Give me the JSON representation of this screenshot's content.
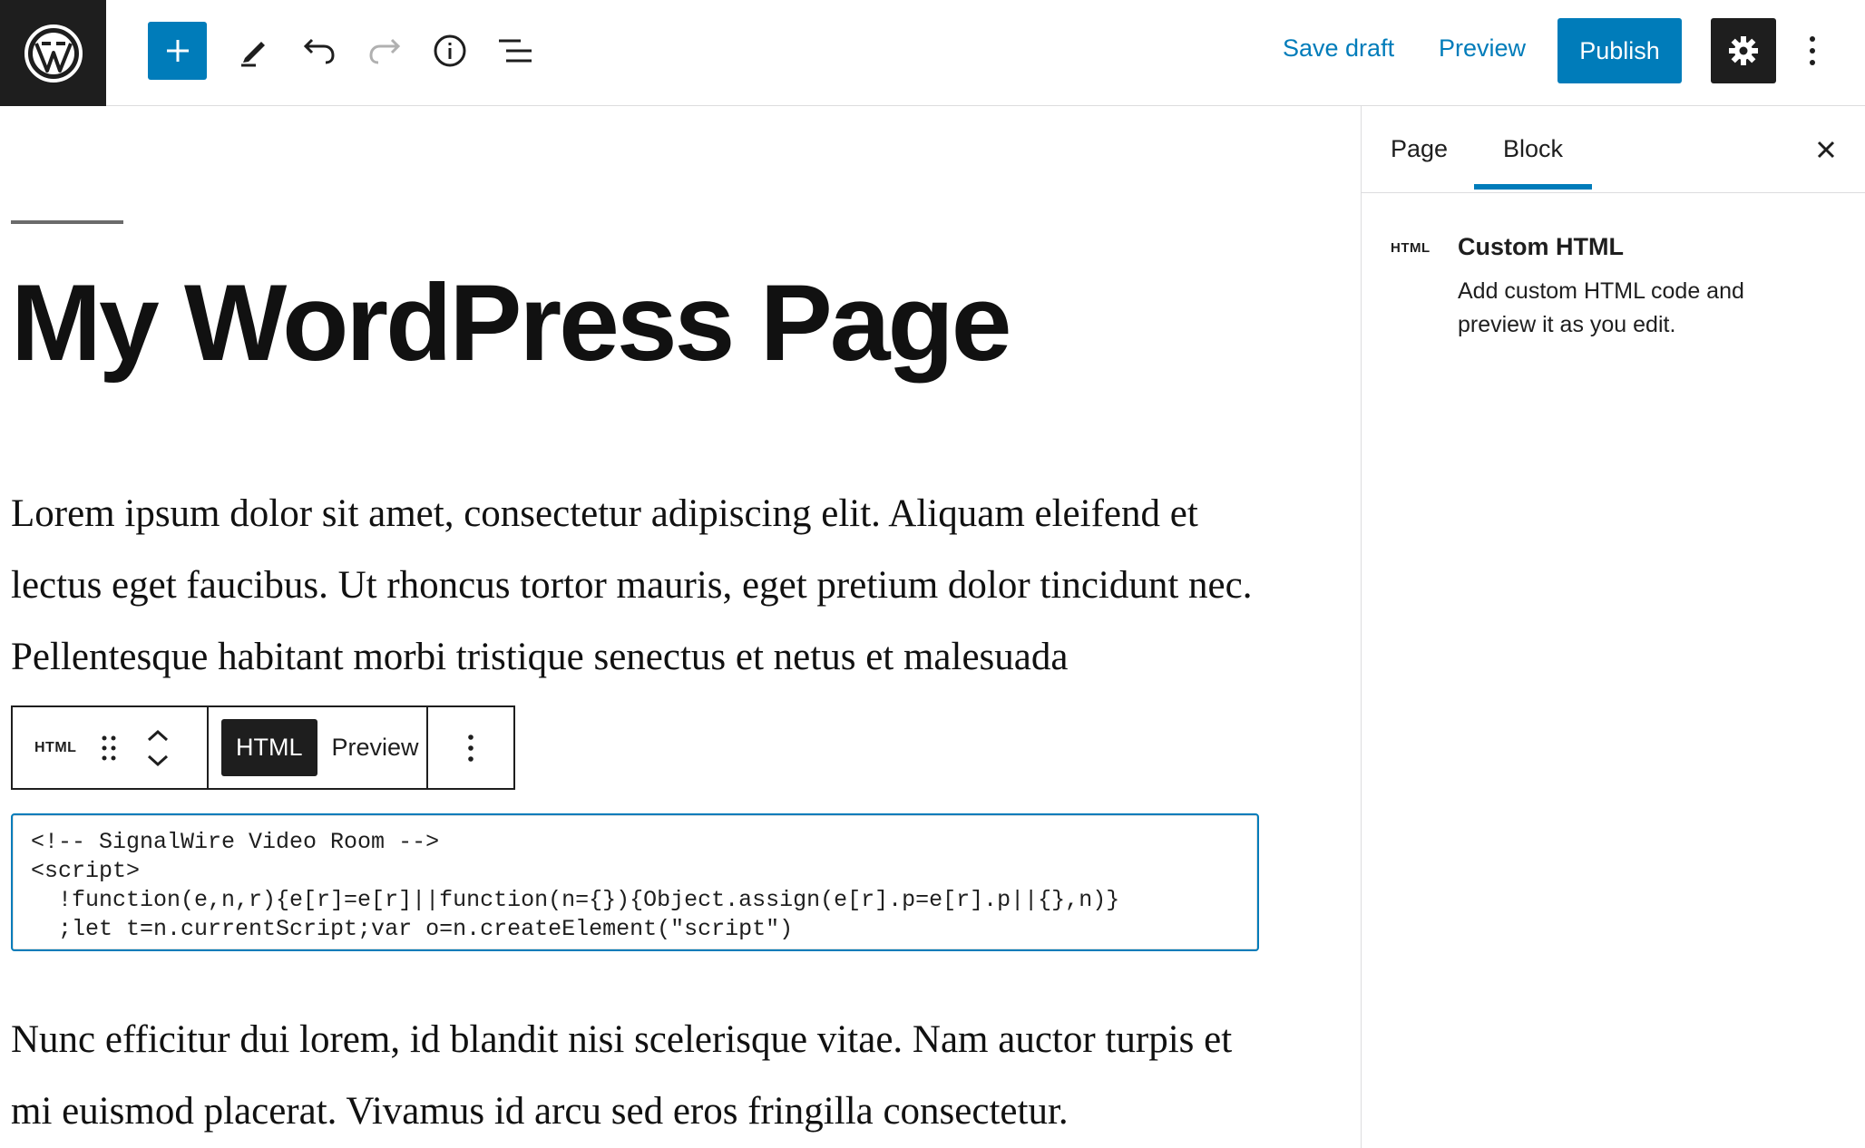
{
  "topbar": {
    "logo_icon": "wordpress-logo-icon",
    "save_draft_label": "Save draft",
    "preview_label": "Preview",
    "publish_label": "Publish",
    "accent_color": "#007cba"
  },
  "editor": {
    "title": "My WordPress Page",
    "paragraph1": "Lorem ipsum dolor sit amet, consectetur adipiscing elit. Aliquam eleifend et lectus eget faucibus. Ut rhoncus tortor mauris, eget pretium dolor tincidunt nec. Pellentesque habitant morbi tristique senectus et netus et malesuada",
    "paragraph2": "Nunc efficitur dui lorem, id blandit nisi scelerisque vitae. Nam auctor turpis et mi euismod placerat. Vivamus id arcu sed eros fringilla consectetur."
  },
  "block_toolbar": {
    "block_type_label": "HTML",
    "html_tab_label": "HTML",
    "preview_tab_label": "Preview"
  },
  "code": {
    "lines": [
      "<!-- SignalWire Video Room -->",
      "<script>",
      "  !function(e,n,r){e[r]=e[r]||function(n={}){Object.assign(e[r].p=e[r].p||{},n)}",
      "  ;let t=n.currentScript;var o=n.createElement(\"script\")"
    ]
  },
  "sidebar": {
    "tab_page": "Page",
    "tab_block": "Block",
    "block_icon_label": "HTML",
    "block_name": "Custom HTML",
    "block_description": "Add custom HTML code and preview it as you edit."
  }
}
